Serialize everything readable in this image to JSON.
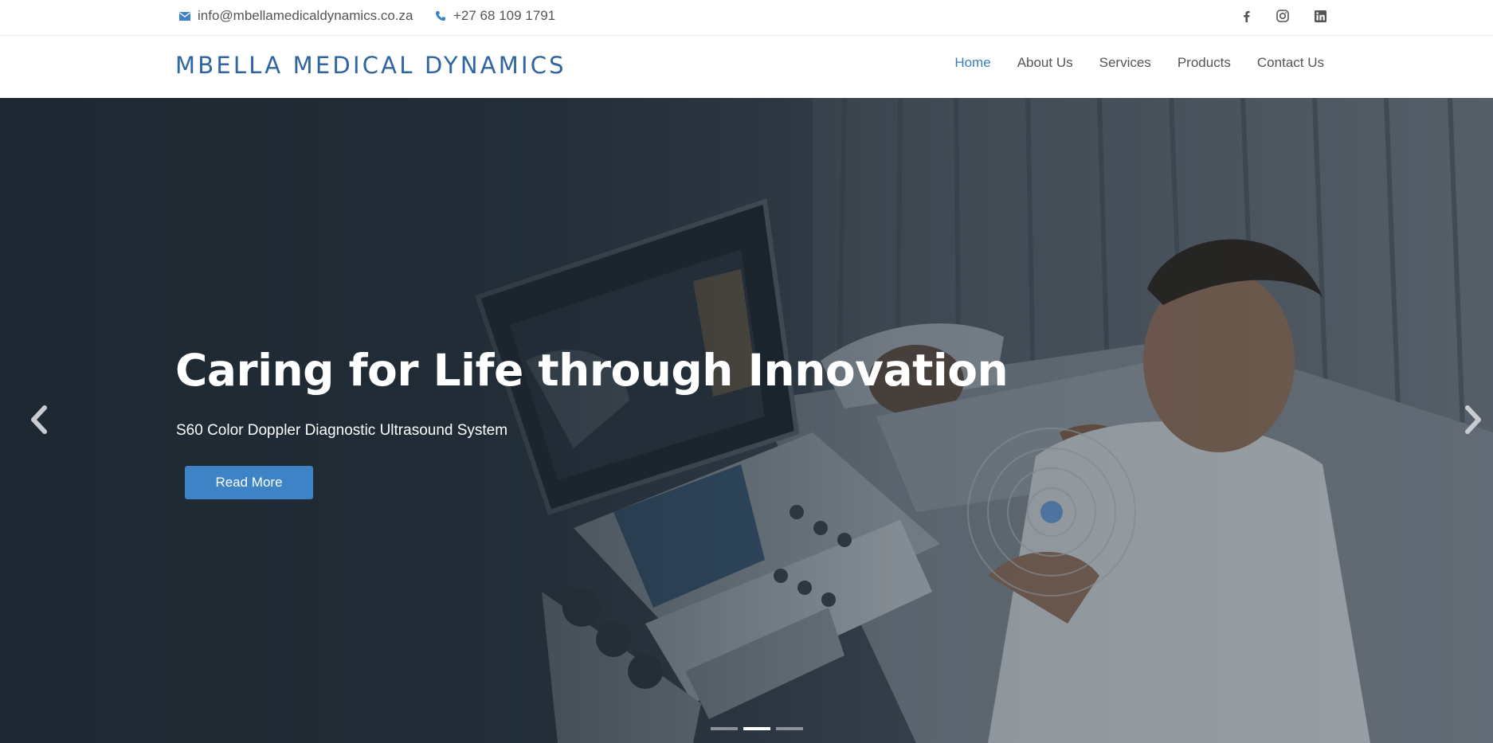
{
  "contact": {
    "email": "info@mbellamedicaldynamics.co.za",
    "phone": "+27 68 109 1791"
  },
  "social": [
    "facebook-icon",
    "instagram-icon",
    "linkedin-icon"
  ],
  "brand": {
    "name": "MBELLA MEDICAL DYNAMICS"
  },
  "nav": {
    "items": [
      {
        "label": "Home",
        "active": true
      },
      {
        "label": "About Us"
      },
      {
        "label": "Services"
      },
      {
        "label": "Products"
      },
      {
        "label": "Contact Us"
      }
    ]
  },
  "hero": {
    "title": "Caring for Life through Innovation",
    "subtitle": "S60 Color Doppler Diagnostic Ultrasound System",
    "button_label": "Read More",
    "slides_total": 3,
    "active_slide": 2
  },
  "colors": {
    "brand": "#2f65a0",
    "accent": "#3f83c7",
    "nav_active": "#3a7fc5"
  }
}
